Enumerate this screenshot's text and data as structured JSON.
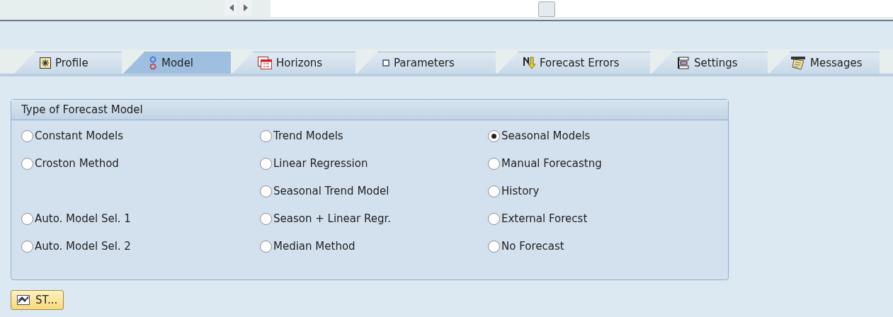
{
  "tabs": [
    {
      "label": "Profile",
      "selected": false
    },
    {
      "label": "Model",
      "selected": true
    },
    {
      "label": "Horizons",
      "selected": false
    },
    {
      "label": "Parameters",
      "selected": false
    },
    {
      "label": "Forecast Errors",
      "selected": false
    },
    {
      "label": "Settings",
      "selected": false
    },
    {
      "label": "Messages",
      "selected": false
    }
  ],
  "group": {
    "title": "Type of Forecast Model",
    "rows": [
      {
        "options": [
          {
            "label": "Constant Models",
            "selected": false
          },
          {
            "label": "Trend Models",
            "selected": false
          },
          {
            "label": "Seasonal Models",
            "selected": true
          }
        ]
      },
      {
        "options": [
          {
            "label": "Croston Method",
            "selected": false
          },
          {
            "label": "Linear Regression",
            "selected": false
          },
          {
            "label": "Manual Forecastng",
            "selected": false
          }
        ]
      },
      {
        "options": [
          {
            "label": "Seasonal Trend Model",
            "selected": false
          },
          {
            "label": "History",
            "selected": false
          }
        ]
      },
      {
        "options": [
          {
            "label": "Auto. Model Sel. 1",
            "selected": false
          },
          {
            "label": "Season + Linear Regr.",
            "selected": false
          },
          {
            "label": "External Forecst",
            "selected": false
          }
        ]
      },
      {
        "options": [
          {
            "label": "Auto. Model Sel. 2",
            "selected": false
          },
          {
            "label": "Median Method",
            "selected": false
          },
          {
            "label": "No Forecast",
            "selected": false
          }
        ]
      }
    ]
  },
  "button": {
    "label": "ST..."
  }
}
